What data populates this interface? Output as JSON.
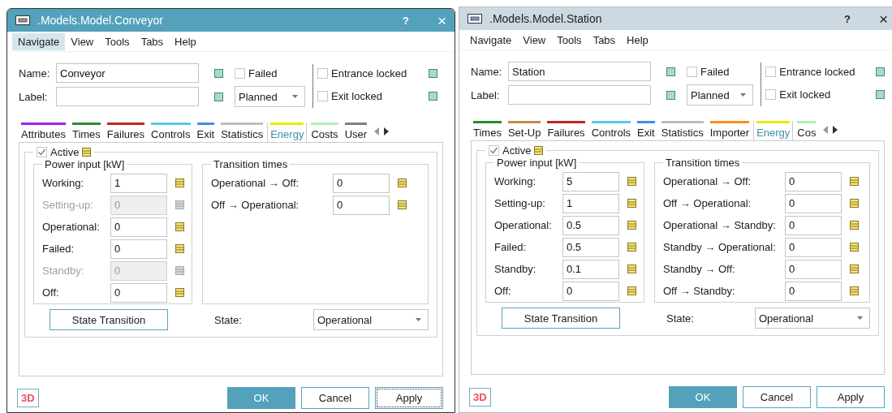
{
  "windows": [
    {
      "title": ".Models.Model.Conveyor",
      "active": true,
      "help": "?",
      "close": "×",
      "menu": [
        {
          "label": "Navigate",
          "selected": true
        },
        {
          "label": "View",
          "selected": false
        },
        {
          "label": "Tools",
          "selected": false
        },
        {
          "label": "Tabs",
          "selected": false
        },
        {
          "label": "Help",
          "selected": false
        }
      ],
      "fields": [
        {
          "label": "Name:",
          "value": "Conveyor"
        },
        {
          "label": "Label:"
        }
      ],
      "failed": {
        "label": "Failed",
        "checked": false
      },
      "plan_dropdown": "Planned",
      "locks": [
        {
          "label": "Entrance locked",
          "checked": false
        },
        {
          "label": "Exit locked",
          "checked": false
        }
      ],
      "tabs": [
        {
          "label": "Attributes",
          "color": "#a51ff0",
          "selected": false
        },
        {
          "label": "Times",
          "color": "#2e8b2e",
          "selected": false
        },
        {
          "label": "Failures",
          "color": "#c42222",
          "selected": false
        },
        {
          "label": "Controls",
          "color": "#55c8ee",
          "selected": false
        },
        {
          "label": "Exit",
          "color": "#3d8ff2",
          "selected": false
        },
        {
          "label": "Statistics",
          "color": "#bdbdbd",
          "selected": false
        },
        {
          "label": "Energy",
          "color": "#eaea00",
          "selected": true
        },
        {
          "label": "Costs",
          "color": "#b3ebb3",
          "selected": false
        },
        {
          "label": "User",
          "color": "#7f7f7f",
          "selected": false
        }
      ],
      "active_box": {
        "label": "Active",
        "checked": true
      },
      "power_input": {
        "title": "Power input [kW]",
        "rows": [
          {
            "label": "Working:",
            "value": "1",
            "disabled": false
          },
          {
            "label": "Setting-up:",
            "value": "0",
            "disabled": true
          },
          {
            "label": "Operational:",
            "value": "0",
            "disabled": false
          },
          {
            "label": "Failed:",
            "value": "0",
            "disabled": false
          },
          {
            "label": "Standby:",
            "value": "0",
            "disabled": true
          },
          {
            "label": "Off:",
            "value": "0",
            "disabled": false
          }
        ]
      },
      "transition_times": {
        "title": "Transition times",
        "rows": [
          {
            "label": "Operational → Off:",
            "value": "0"
          },
          {
            "label": "Off → Operational:",
            "value": "0"
          }
        ]
      },
      "state_button": "State Transition",
      "state_label": "State:",
      "state_dropdown": "Operational",
      "badge": "3D",
      "buttons": [
        {
          "label": "OK",
          "kind": "primary"
        },
        {
          "label": "Cancel",
          "kind": "normal"
        },
        {
          "label": "Apply",
          "kind": "focused"
        }
      ]
    },
    {
      "title": ".Models.Model.Station",
      "active": false,
      "help": "?",
      "close": "×",
      "menu": [
        {
          "label": "Navigate",
          "selected": false
        },
        {
          "label": "View",
          "selected": false
        },
        {
          "label": "Tools",
          "selected": false
        },
        {
          "label": "Tabs",
          "selected": false
        },
        {
          "label": "Help",
          "selected": false
        }
      ],
      "fields": [
        {
          "label": "Name:",
          "value": "Station"
        },
        {
          "label": "Label:"
        }
      ],
      "failed": {
        "label": "Failed",
        "checked": false
      },
      "plan_dropdown": "Planned",
      "locks": [
        {
          "label": "Entrance locked",
          "checked": false
        },
        {
          "label": "Exit locked",
          "checked": false
        }
      ],
      "tabs": [
        {
          "label": "Times",
          "color": "#2e8b2e",
          "selected": false
        },
        {
          "label": "Set-Up",
          "color": "#c08c45",
          "selected": false
        },
        {
          "label": "Failures",
          "color": "#c42222",
          "selected": false
        },
        {
          "label": "Controls",
          "color": "#55c8ee",
          "selected": false
        },
        {
          "label": "Exit",
          "color": "#3d8ff2",
          "selected": false
        },
        {
          "label": "Statistics",
          "color": "#bdbdbd",
          "selected": false
        },
        {
          "label": "Importer",
          "color": "#ff8c1a",
          "selected": false
        },
        {
          "label": "Energy",
          "color": "#eaea00",
          "selected": true
        },
        {
          "label": "Cos",
          "color": "#b3ebb3",
          "selected": false
        }
      ],
      "active_box": {
        "label": "Active",
        "checked": true
      },
      "power_input": {
        "title": "Power input [kW]",
        "rows": [
          {
            "label": "Working:",
            "value": "5",
            "disabled": false
          },
          {
            "label": "Setting-up:",
            "value": "1",
            "disabled": false
          },
          {
            "label": "Operational:",
            "value": "0.5",
            "disabled": false
          },
          {
            "label": "Failed:",
            "value": "0.5",
            "disabled": false
          },
          {
            "label": "Standby:",
            "value": "0.1",
            "disabled": false
          },
          {
            "label": "Off:",
            "value": "0",
            "disabled": false
          }
        ]
      },
      "transition_times": {
        "title": "Transition times",
        "rows": [
          {
            "label": "Operational → Off:",
            "value": "0"
          },
          {
            "label": "Off → Operational:",
            "value": "0"
          },
          {
            "label": "Operational → Standby:",
            "value": "0"
          },
          {
            "label": "Standby → Operational:",
            "value": "0"
          },
          {
            "label": "Standby → Off:",
            "value": "0"
          },
          {
            "label": "Off → Standby:",
            "value": "0"
          }
        ]
      },
      "state_button": "State Transition",
      "state_label": "State:",
      "state_dropdown": "Operational",
      "badge": "3D",
      "buttons": [
        {
          "label": "OK",
          "kind": "primary"
        },
        {
          "label": "Cancel",
          "kind": "normal"
        },
        {
          "label": "Apply",
          "kind": "normal"
        }
      ]
    }
  ]
}
